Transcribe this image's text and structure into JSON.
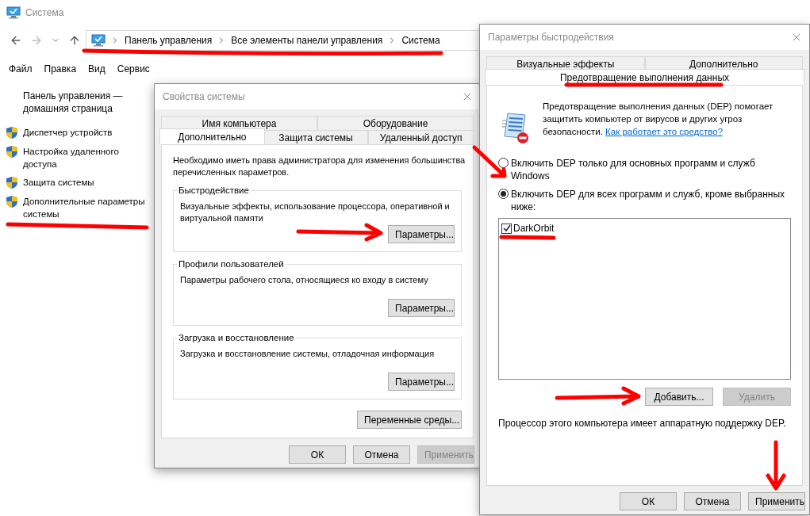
{
  "main_window": {
    "title": "Система",
    "breadcrumb": [
      "Панель управления",
      "Все элементы панели управления",
      "Система"
    ],
    "menu": [
      "Файл",
      "Правка",
      "Вид",
      "Сервис"
    ],
    "sidebar": {
      "home_link": "Панель управления — домашняя страница",
      "items": [
        "Диспетчер устройств",
        "Настройка удаленного доступа",
        "Защита системы",
        "Дополнительные параметры системы"
      ]
    }
  },
  "system_properties": {
    "title": "Свойства системы",
    "tab_rows": [
      {
        "tabs": [
          {
            "label": "Имя компьютера",
            "selected": false
          },
          {
            "label": "Оборудование",
            "selected": false
          }
        ]
      },
      {
        "tabs": [
          {
            "label": "Дополнительно",
            "selected": true
          },
          {
            "label": "Защита системы",
            "selected": false
          },
          {
            "label": "Удаленный доступ",
            "selected": false
          }
        ]
      }
    ],
    "intro": "Необходимо иметь права администратора для изменения большинства перечисленных параметров.",
    "groups": [
      {
        "title": "Быстродействие",
        "description": "Визуальные эффекты, использование процессора, оперативной и виртуальной памяти",
        "button": "Параметры..."
      },
      {
        "title": "Профили пользователей",
        "description": "Параметры рабочего стола, относящиеся ко входу в систему",
        "button": "Параметры..."
      },
      {
        "title": "Загрузка и восстановление",
        "description": "Загрузка и восстановление системы, отладочная информация",
        "button": "Параметры..."
      }
    ],
    "env_button": "Переменные среды...",
    "buttons": [
      {
        "label": "ОК",
        "disabled": false
      },
      {
        "label": "Отмена",
        "disabled": false
      },
      {
        "label": "Применить",
        "disabled": true
      }
    ]
  },
  "performance_options": {
    "title": "Параметры быстродействия",
    "tab_rows": [
      {
        "tabs": [
          {
            "label": "Визуальные эффекты",
            "selected": false
          },
          {
            "label": "Дополнительно",
            "selected": false
          }
        ]
      },
      {
        "tabs": [
          {
            "label": "Предотвращение выполнения данных",
            "selected": true
          }
        ]
      }
    ],
    "description": "Предотвращение выполнения данных (DEP) помогает защитить компьютер от вирусов и других угроз безопасности.",
    "help_link": "Как работает это средство?",
    "options": [
      {
        "label": "Включить DEP только для основных программ и служб Windows",
        "selected": false
      },
      {
        "label": "Включить DEP для всех программ и служб, кроме выбранных ниже:",
        "selected": true
      }
    ],
    "exceptions": [
      {
        "label": "DarkOrbit",
        "checked": true
      }
    ],
    "list_buttons": [
      {
        "label": "Добавить...",
        "disabled": false
      },
      {
        "label": "Удалить",
        "disabled": true
      }
    ],
    "hardware_note": "Процессор этого компьютера имеет аппаратную поддержку DEP.",
    "buttons": [
      {
        "label": "ОК",
        "disabled": false
      },
      {
        "label": "Отмена",
        "disabled": false
      },
      {
        "label": "Применить",
        "disabled": false
      }
    ]
  }
}
